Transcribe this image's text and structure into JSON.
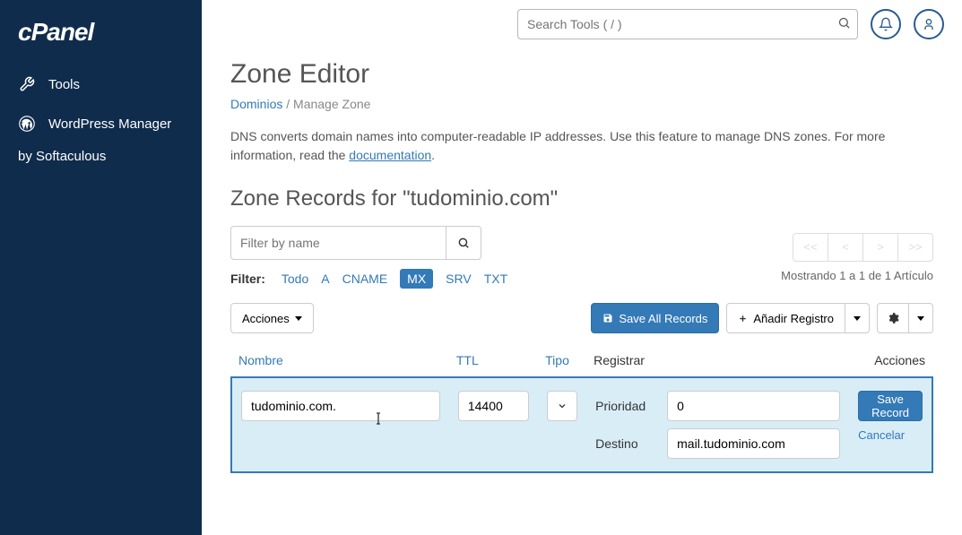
{
  "brand": "cPanel",
  "sidebar": {
    "items": [
      {
        "label": "Tools",
        "icon": "tools-icon"
      },
      {
        "label": "WordPress Manager",
        "icon": "wordpress-icon"
      }
    ],
    "sub": "by Softaculous"
  },
  "topbar": {
    "search_placeholder": "Search Tools ( / )"
  },
  "page": {
    "title": "Zone Editor",
    "breadcrumb": {
      "link": "Dominios",
      "sep": "/",
      "current": "Manage Zone"
    },
    "description_pre": "DNS converts domain names into computer-readable IP addresses. Use this feature to manage DNS zones. For more information, read the ",
    "description_link": "documentation",
    "description_post": ".",
    "section_title": "Zone Records for \"tudominio.com\""
  },
  "filter": {
    "placeholder": "Filter by name",
    "label": "Filter:",
    "types": [
      "Todo",
      "A",
      "CNAME",
      "MX",
      "SRV",
      "TXT"
    ],
    "active": "MX",
    "pagination": [
      "<<",
      "<",
      ">",
      ">>"
    ],
    "showing": "Mostrando 1 a 1 de 1 Artículo"
  },
  "toolbar": {
    "actions": "Acciones",
    "save_all": "Save All Records",
    "add_record": "Añadir Registro"
  },
  "columns": {
    "name": "Nombre",
    "ttl": "TTL",
    "type": "Tipo",
    "record": "Registrar",
    "actions": "Acciones"
  },
  "record": {
    "name": "tudominio.com.",
    "ttl": "14400",
    "fields": {
      "priority_label": "Prioridad",
      "priority_value": "0",
      "destination_label": "Destino",
      "destination_value": "mail.tudominio.com"
    },
    "save": "Save Record",
    "cancel": "Cancelar"
  }
}
